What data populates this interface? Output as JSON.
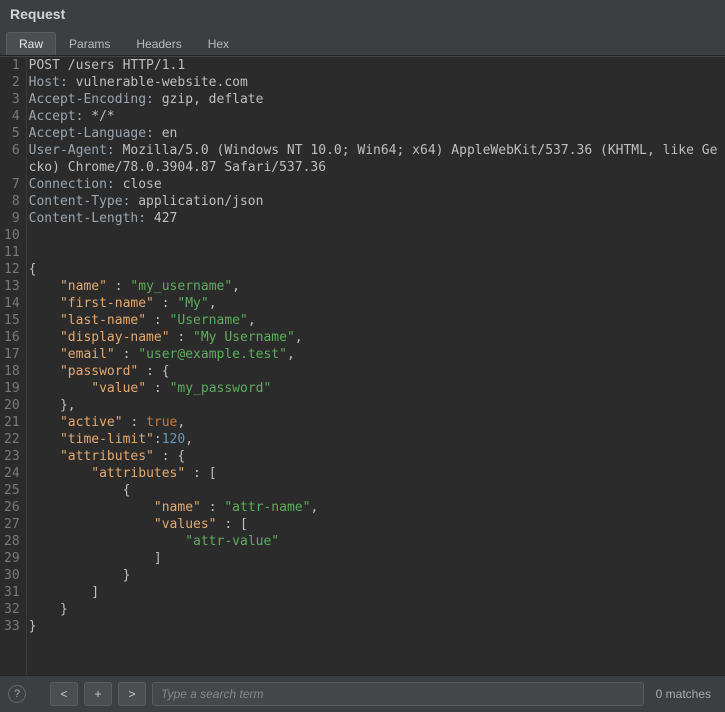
{
  "panel_title": "Request",
  "tabs": [
    "Raw",
    "Params",
    "Headers",
    "Hex"
  ],
  "active_tab": 0,
  "request": {
    "method": "POST",
    "path": "/users",
    "protocol": "HTTP/1.1",
    "headers": [
      {
        "name": "Host",
        "value": "vulnerable-website.com"
      },
      {
        "name": "Accept-Encoding",
        "value": "gzip, deflate"
      },
      {
        "name": "Accept",
        "value": "*/*"
      },
      {
        "name": "Accept-Language",
        "value": "en"
      },
      {
        "name": "User-Agent",
        "value": "Mozilla/5.0 (Windows NT 10.0; Win64; x64) AppleWebKit/537.36 (KHTML, like Gecko) Chrome/78.0.3904.87 Safari/537.36"
      },
      {
        "name": "Connection",
        "value": "close"
      },
      {
        "name": "Content-Type",
        "value": "application/json"
      },
      {
        "name": "Content-Length",
        "value": "427"
      }
    ],
    "body_json": {
      "name": "my_username",
      "first-name": "My",
      "last-name": "Username",
      "display-name": "My Username",
      "email": "user@example.test",
      "password": {
        "value": "my_password"
      },
      "active": true,
      "time-limit": 120,
      "attributes": {
        "attributes": [
          {
            "name": "attr-name",
            "values": [
              "attr-value"
            ]
          }
        ]
      }
    }
  },
  "search": {
    "placeholder": "Type a search term",
    "prev_label": "<",
    "add_label": "+",
    "next_label": ">",
    "matches_text": "0 matches"
  },
  "help_label": "?"
}
